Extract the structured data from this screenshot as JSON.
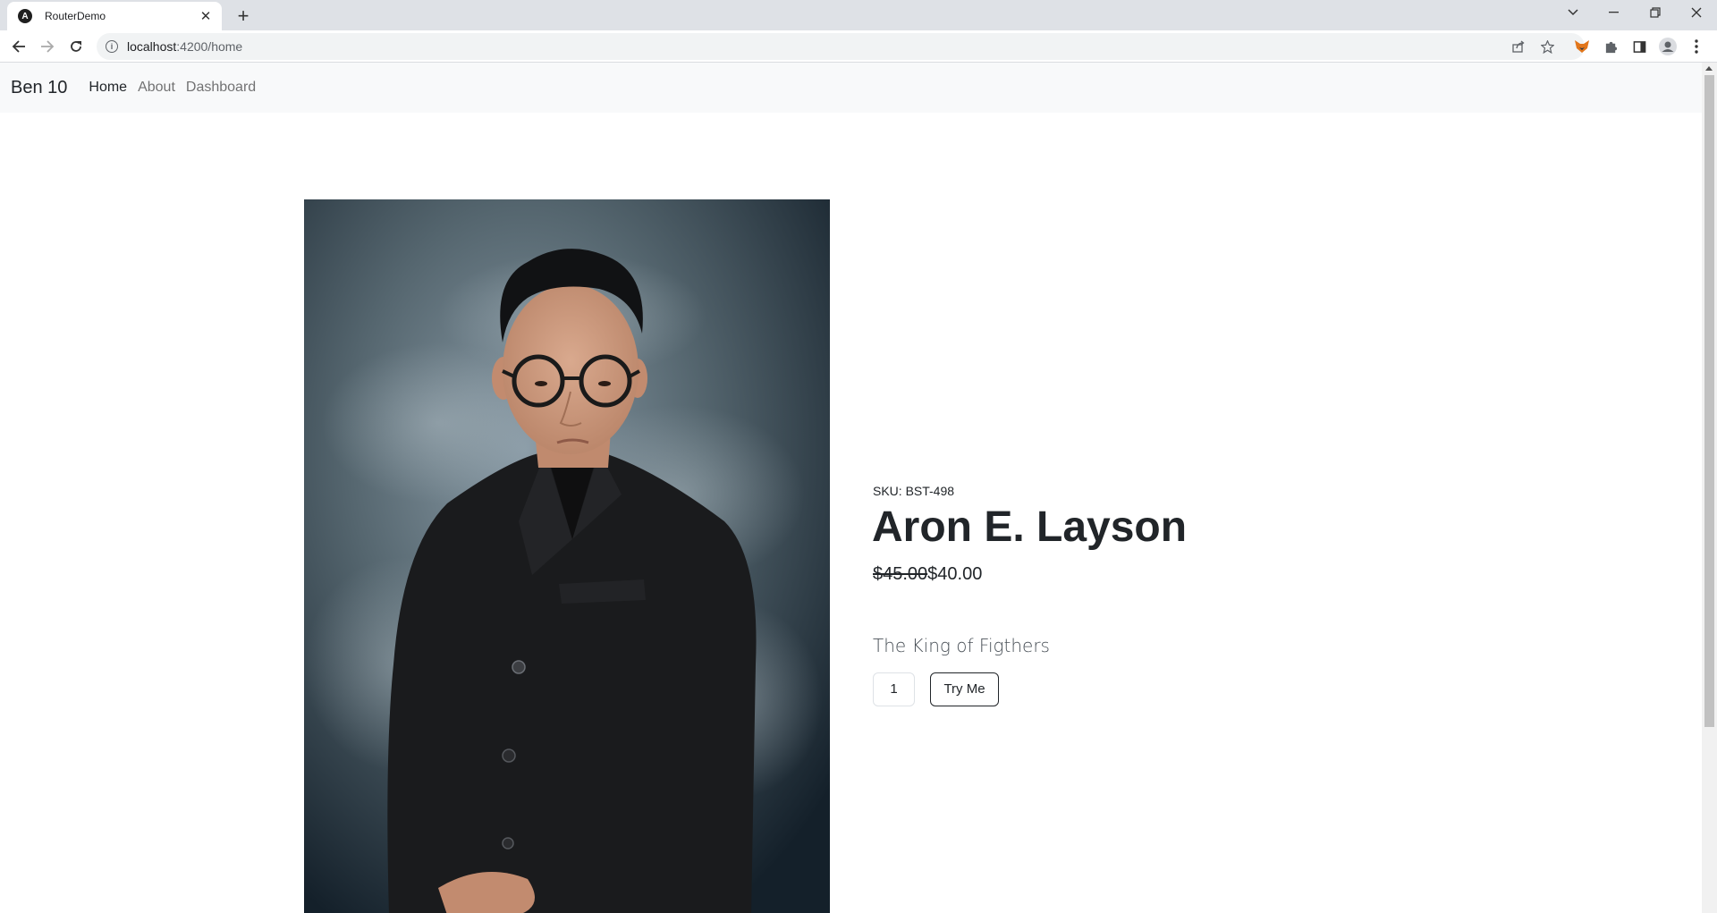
{
  "browser": {
    "tab_title": "RouterDemo",
    "tab_favicon_glyph": "A",
    "tab_close_glyph": "✕",
    "new_tab_glyph": "+",
    "url_host": "localhost",
    "url_path": ":4200/home",
    "icons": [
      "back-icon",
      "forward-icon",
      "reload-icon",
      "info-icon",
      "share-icon",
      "star-icon",
      "fox-extension-icon",
      "puzzle-icon",
      "side-panel-icon",
      "profile-icon",
      "kebab-menu-icon",
      "tab-search-icon",
      "minimize-icon",
      "restore-icon",
      "close-window-icon"
    ]
  },
  "navbar": {
    "brand": "Ben 10",
    "links": [
      {
        "label": "Home",
        "active": true
      },
      {
        "label": "About",
        "active": false
      },
      {
        "label": "Dashboard",
        "active": false
      }
    ]
  },
  "product": {
    "sku": "SKU: BST-498",
    "title": "Aron E. Layson",
    "old_price": "$45.00",
    "price": "$40.00",
    "description": "The King of Figthers",
    "quantity": "1",
    "button_label": "Try Me"
  },
  "colors": {
    "navbar_bg": "#f8f9fa",
    "text": "#212529",
    "photo_bg_center": "#8a9ba6",
    "photo_bg_edge": "#14202a",
    "suit": "#1a1b1d"
  }
}
